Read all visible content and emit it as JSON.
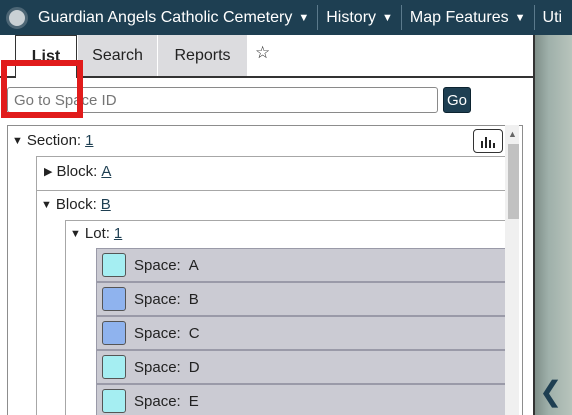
{
  "navbar": {
    "items": [
      {
        "label": "Guardian Angels Catholic Cemetery"
      },
      {
        "label": "History"
      },
      {
        "label": "Map Features"
      },
      {
        "label": "Uti"
      }
    ]
  },
  "tabs": [
    {
      "label": "List"
    },
    {
      "label": "Search"
    },
    {
      "label": "Reports"
    }
  ],
  "goto": {
    "placeholder": "Go to Space ID",
    "button": "Go"
  },
  "tree": {
    "section": {
      "label": "Section:",
      "value": "1"
    },
    "blocks": [
      {
        "label": "Block:",
        "value": "A"
      },
      {
        "label": "Block:",
        "value": "B"
      }
    ],
    "lot": {
      "label": "Lot:",
      "value": "1"
    },
    "spaces": [
      {
        "label": "Space:",
        "id": "A",
        "color": "#a5eef2"
      },
      {
        "label": "Space:",
        "id": "B",
        "color": "#8fb3ee"
      },
      {
        "label": "Space:",
        "id": "C",
        "color": "#8fb3ee"
      },
      {
        "label": "Space:",
        "id": "D",
        "color": "#a5eef2"
      },
      {
        "label": "Space:",
        "id": "E",
        "color": "#a5eef2"
      }
    ]
  },
  "colors": {
    "navbar": "#1e3f52",
    "highlight": "#e11b1b"
  }
}
